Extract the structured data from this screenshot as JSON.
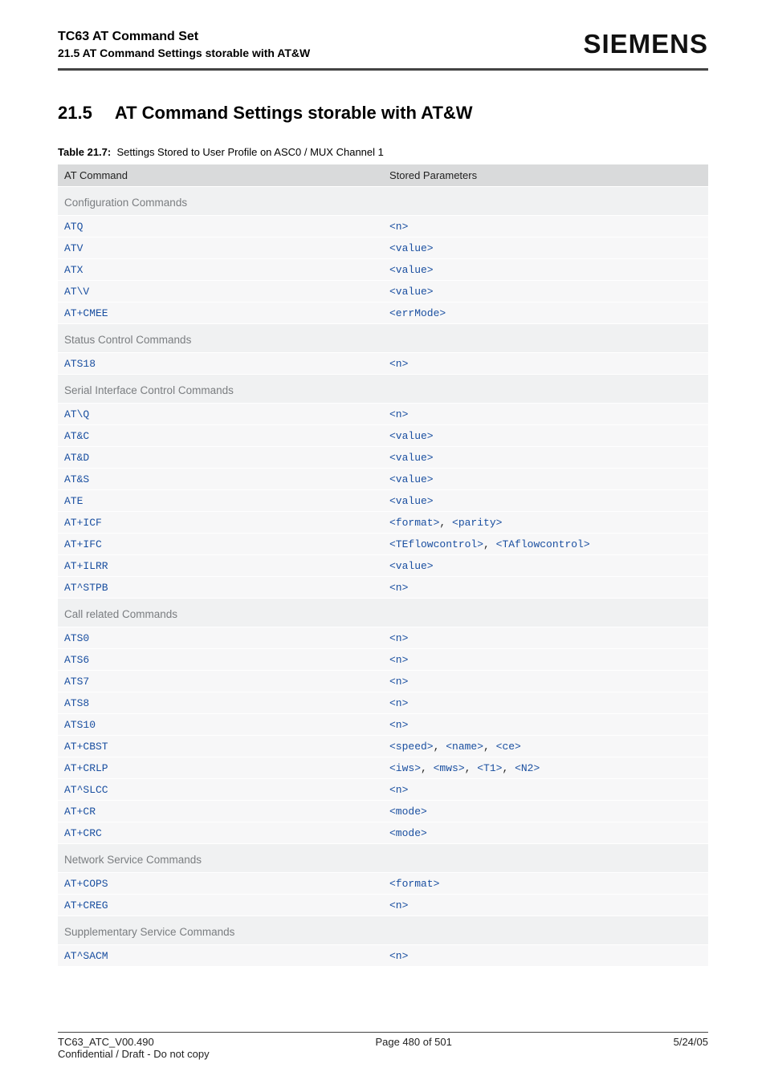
{
  "header": {
    "doc_title": "TC63 AT Command Set",
    "doc_subtitle": "21.5 AT Command Settings storable with AT&W",
    "brand": "SIEMENS"
  },
  "section": {
    "number": "21.5",
    "title": "AT Command Settings storable with AT&W"
  },
  "table_caption_label": "Table 21.7:",
  "table_caption_text": "Settings Stored to User Profile on ASC0 / MUX Channel 1",
  "table_headers": {
    "col1": "AT Command",
    "col2": "Stored Parameters"
  },
  "groups": [
    {
      "name": "Configuration Commands",
      "rows": [
        {
          "cmd": "ATQ",
          "params": [
            "<n>"
          ]
        },
        {
          "cmd": "ATV",
          "params": [
            "<value>"
          ]
        },
        {
          "cmd": "ATX",
          "params": [
            "<value>"
          ]
        },
        {
          "cmd": "AT\\V",
          "params": [
            "<value>"
          ]
        },
        {
          "cmd": "AT+CMEE",
          "params": [
            "<errMode>"
          ]
        }
      ]
    },
    {
      "name": "Status Control Commands",
      "rows": [
        {
          "cmd": "ATS18",
          "params": [
            "<n>"
          ]
        }
      ]
    },
    {
      "name": "Serial Interface Control Commands",
      "rows": [
        {
          "cmd": "AT\\Q",
          "params": [
            "<n>"
          ]
        },
        {
          "cmd": "AT&C",
          "params": [
            "<value>"
          ]
        },
        {
          "cmd": "AT&D",
          "params": [
            "<value>"
          ]
        },
        {
          "cmd": "AT&S",
          "params": [
            "<value>"
          ]
        },
        {
          "cmd": "ATE",
          "params": [
            "<value>"
          ]
        },
        {
          "cmd": "AT+ICF",
          "params": [
            "<format>",
            "<parity>"
          ]
        },
        {
          "cmd": "AT+IFC",
          "params": [
            "<TEflowcontrol>",
            "<TAflowcontrol>"
          ]
        },
        {
          "cmd": "AT+ILRR",
          "params": [
            "<value>"
          ]
        },
        {
          "cmd": "AT^STPB",
          "params": [
            "<n>"
          ]
        }
      ]
    },
    {
      "name": "Call related Commands",
      "rows": [
        {
          "cmd": "ATS0",
          "params": [
            "<n>"
          ]
        },
        {
          "cmd": "ATS6",
          "params": [
            "<n>"
          ]
        },
        {
          "cmd": "ATS7",
          "params": [
            "<n>"
          ]
        },
        {
          "cmd": "ATS8",
          "params": [
            "<n>"
          ]
        },
        {
          "cmd": "ATS10",
          "params": [
            "<n>"
          ]
        },
        {
          "cmd": "AT+CBST",
          "params": [
            "<speed>",
            "<name>",
            "<ce>"
          ]
        },
        {
          "cmd": "AT+CRLP",
          "params": [
            "<iws>",
            "<mws>",
            "<T1>",
            "<N2>"
          ]
        },
        {
          "cmd": "AT^SLCC",
          "params": [
            "<n>"
          ]
        },
        {
          "cmd": "AT+CR",
          "params": [
            "<mode>"
          ]
        },
        {
          "cmd": "AT+CRC",
          "params": [
            "<mode>"
          ]
        }
      ]
    },
    {
      "name": "Network Service Commands",
      "rows": [
        {
          "cmd": "AT+COPS",
          "params": [
            "<format>"
          ]
        },
        {
          "cmd": "AT+CREG",
          "params": [
            "<n>"
          ]
        }
      ]
    },
    {
      "name": "Supplementary Service Commands",
      "rows": [
        {
          "cmd": "AT^SACM",
          "params": [
            "<n>"
          ]
        }
      ]
    }
  ],
  "footer": {
    "left": "TC63_ATC_V00.490",
    "center": "Page 480 of 501",
    "right": "5/24/05",
    "left2": "Confidential / Draft - Do not copy"
  }
}
